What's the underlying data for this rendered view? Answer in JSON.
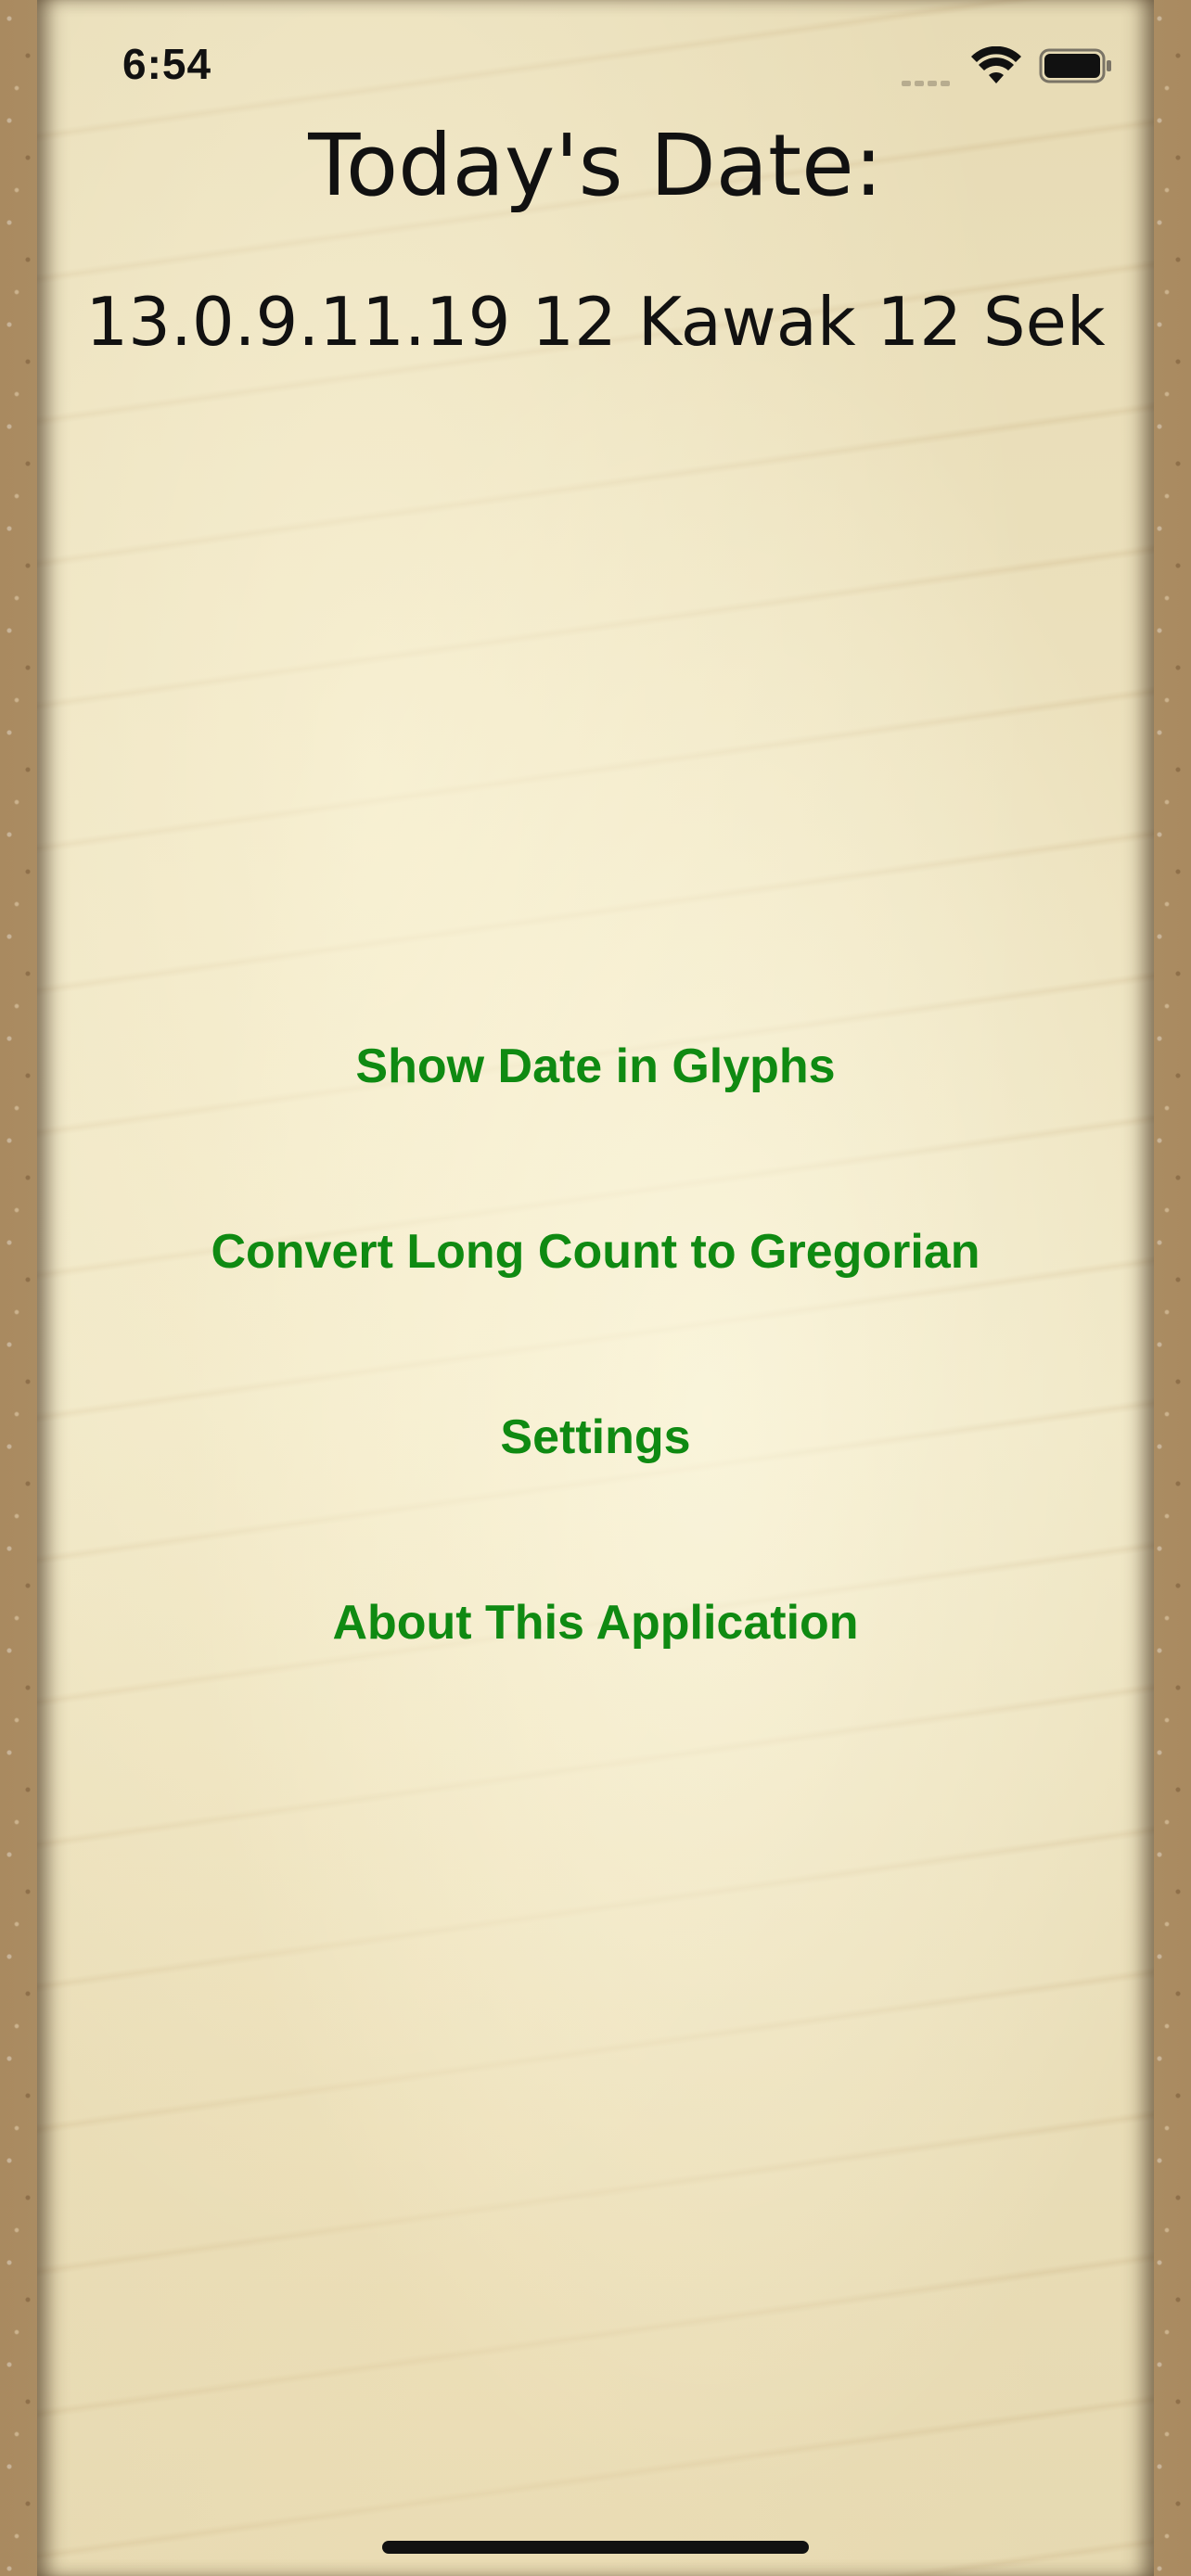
{
  "status_bar": {
    "time": "6:54",
    "icons": [
      "signal-icon",
      "wifi-icon",
      "battery-icon"
    ]
  },
  "header": {
    "title": "Today's Date:",
    "date": "13.0.9.11.19 12 Kawak 12 Sek"
  },
  "menu": {
    "items": [
      {
        "label": "Show Date in Glyphs"
      },
      {
        "label": "Convert Long Count to Gregorian"
      },
      {
        "label": "Settings"
      },
      {
        "label": "About This Application"
      }
    ]
  },
  "colors": {
    "link_green": "#0f8a12",
    "text": "#111111",
    "parchment": "#ece1bd",
    "sand_border": "#b89a6e"
  }
}
